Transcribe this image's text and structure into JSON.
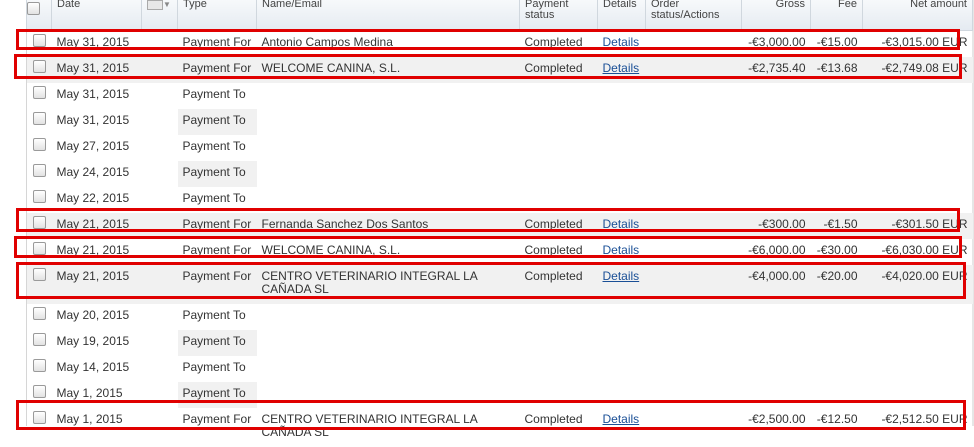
{
  "columns": {
    "date": "Date",
    "type": "Type",
    "name": "Name/Email",
    "payment_status": "Payment status",
    "details": "Details",
    "order_status": "Order status/Actions",
    "gross": "Gross",
    "fee": "Fee",
    "net": "Net amount"
  },
  "rows": [
    {
      "date": "May 31, 2015",
      "type": "Payment For",
      "name": "Antonio Campos Medina",
      "status": "Completed",
      "details": "Details",
      "gross": "-€3,000.00",
      "fee": "-€15.00",
      "net": "-€3,015.00 EUR"
    },
    {
      "date": "May 31, 2015",
      "type": "Payment For",
      "name": "WELCOME CANINA, S.L.",
      "status": "Completed",
      "details": "Details",
      "gross": "-€2,735.40",
      "fee": "-€13.68",
      "net": "-€2,749.08 EUR"
    },
    {
      "date": "May 31, 2015",
      "type": "Payment To"
    },
    {
      "date": "May 31, 2015",
      "type": "Payment To"
    },
    {
      "date": "May 27, 2015",
      "type": "Payment To"
    },
    {
      "date": "May 24, 2015",
      "type": "Payment To"
    },
    {
      "date": "May 22, 2015",
      "type": "Payment To"
    },
    {
      "date": "May 21, 2015",
      "type": "Payment For",
      "name": "Fernanda Sanchez Dos Santos",
      "status": "Completed",
      "details": "Details",
      "gross": "-€300.00",
      "fee": "-€1.50",
      "net": "-€301.50 EUR"
    },
    {
      "date": "May 21, 2015",
      "type": "Payment For",
      "name": "WELCOME CANINA, S.L.",
      "status": "Completed",
      "details": "Details",
      "gross": "-€6,000.00",
      "fee": "-€30.00",
      "net": "-€6,030.00 EUR"
    },
    {
      "date": "May 21, 2015",
      "type": "Payment For",
      "name": "CENTRO VETERINARIO INTEGRAL LA CAÑADA SL",
      "status": "Completed",
      "details": "Details",
      "gross": "-€4,000.00",
      "fee": "-€20.00",
      "net": "-€4,020.00 EUR"
    },
    {
      "date": "May 20, 2015",
      "type": "Payment To"
    },
    {
      "date": "May 19, 2015",
      "type": "Payment To"
    },
    {
      "date": "May 14, 2015",
      "type": "Payment To"
    },
    {
      "date": "May 1, 2015",
      "type": "Payment To"
    },
    {
      "date": "May 1, 2015",
      "type": "Payment For",
      "name": "CENTRO VETERINARIO INTEGRAL LA CAÑADA SL",
      "status": "Completed",
      "details": "Details",
      "gross": "-€2,500.00",
      "fee": "-€12.50",
      "net": "-€2,512.50 EUR"
    }
  ],
  "colors": {
    "highlight": "#e00000",
    "link": "#1a4f96",
    "row_shade": "#f1f1f1"
  },
  "icons": {
    "flag_column": "flag-icon"
  }
}
